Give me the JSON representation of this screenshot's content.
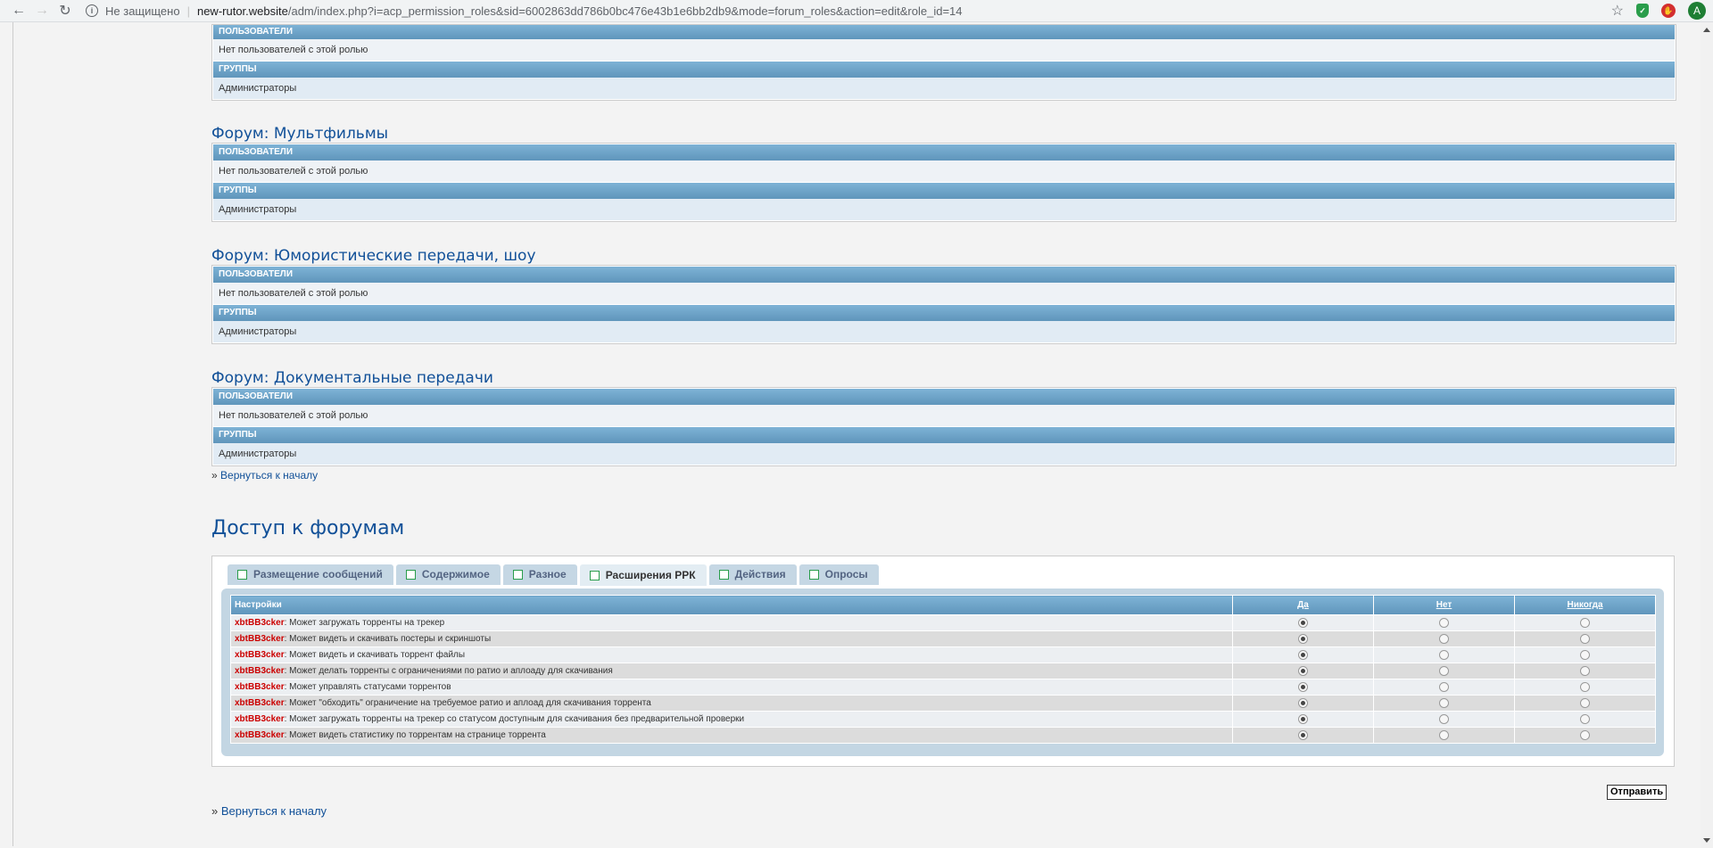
{
  "browser": {
    "insecure_label": "Не защищено",
    "url_host": "new-rutor.website",
    "url_path": "/adm/index.php?i=acp_permission_roles&sid=6002863dd786b0bc476e43b1e6bb2db9&mode=forum_roles&action=edit&role_id=14",
    "avatar_letter": "A"
  },
  "forums": [
    {
      "title": "",
      "users_label": "ПОЛЬЗОВАТЕЛИ",
      "users_value": "Нет пользователей с этой ролью",
      "groups_label": "ГРУППЫ",
      "groups_value": "Администраторы"
    },
    {
      "title": "Форум: Мультфильмы",
      "users_label": "ПОЛЬЗОВАТЕЛИ",
      "users_value": "Нет пользователей с этой ролью",
      "groups_label": "ГРУППЫ",
      "groups_value": "Администраторы"
    },
    {
      "title": "Форум: Юмористические передачи, шоу",
      "users_label": "ПОЛЬЗОВАТЕЛИ",
      "users_value": "Нет пользователей с этой ролью",
      "groups_label": "ГРУППЫ",
      "groups_value": "Администраторы"
    },
    {
      "title": "Форум: Документальные передачи",
      "users_label": "ПОЛЬЗОВАТЕЛИ",
      "users_value": "Нет пользователей с этой ролью",
      "groups_label": "ГРУППЫ",
      "groups_value": "Администраторы"
    }
  ],
  "back_link": "Вернуться к началу",
  "access": {
    "title": "Доступ к форумам",
    "tabs": [
      {
        "label": "Размещение сообщений",
        "active": false
      },
      {
        "label": "Содержимое",
        "active": false
      },
      {
        "label": "Разное",
        "active": false
      },
      {
        "label": "Расширения РРК",
        "active": true
      },
      {
        "label": "Действия",
        "active": false
      },
      {
        "label": "Опросы",
        "active": false
      }
    ],
    "columns": {
      "settings": "Настройки",
      "yes": "Да",
      "no": "Нет",
      "never": "Никогда"
    },
    "prefix": "xbtBB3cker",
    "rows": [
      {
        "text": "Может загружать торренты на трекер",
        "selected": "yes"
      },
      {
        "text": "Может видеть и скачивать постеры и скриншоты",
        "selected": "yes"
      },
      {
        "text": "Может видеть и скачивать торрент файлы",
        "selected": "yes"
      },
      {
        "text": "Может делать торренты с ограничениями по ратио и аплоаду для скачивания",
        "selected": "yes"
      },
      {
        "text": "Может управлять статусами торрентов",
        "selected": "yes"
      },
      {
        "text": "Может \"обходить\" ограничение на требуемое ратио и аплоад для скачивания торрента",
        "selected": "yes"
      },
      {
        "text": "Может загружать торренты на трекер со статусом доступным для скачивания без предварительной проверки",
        "selected": "yes"
      },
      {
        "text": "Может видеть статистику по торрентам на странице торрента",
        "selected": "yes"
      }
    ]
  },
  "submit_label": "Отправить"
}
